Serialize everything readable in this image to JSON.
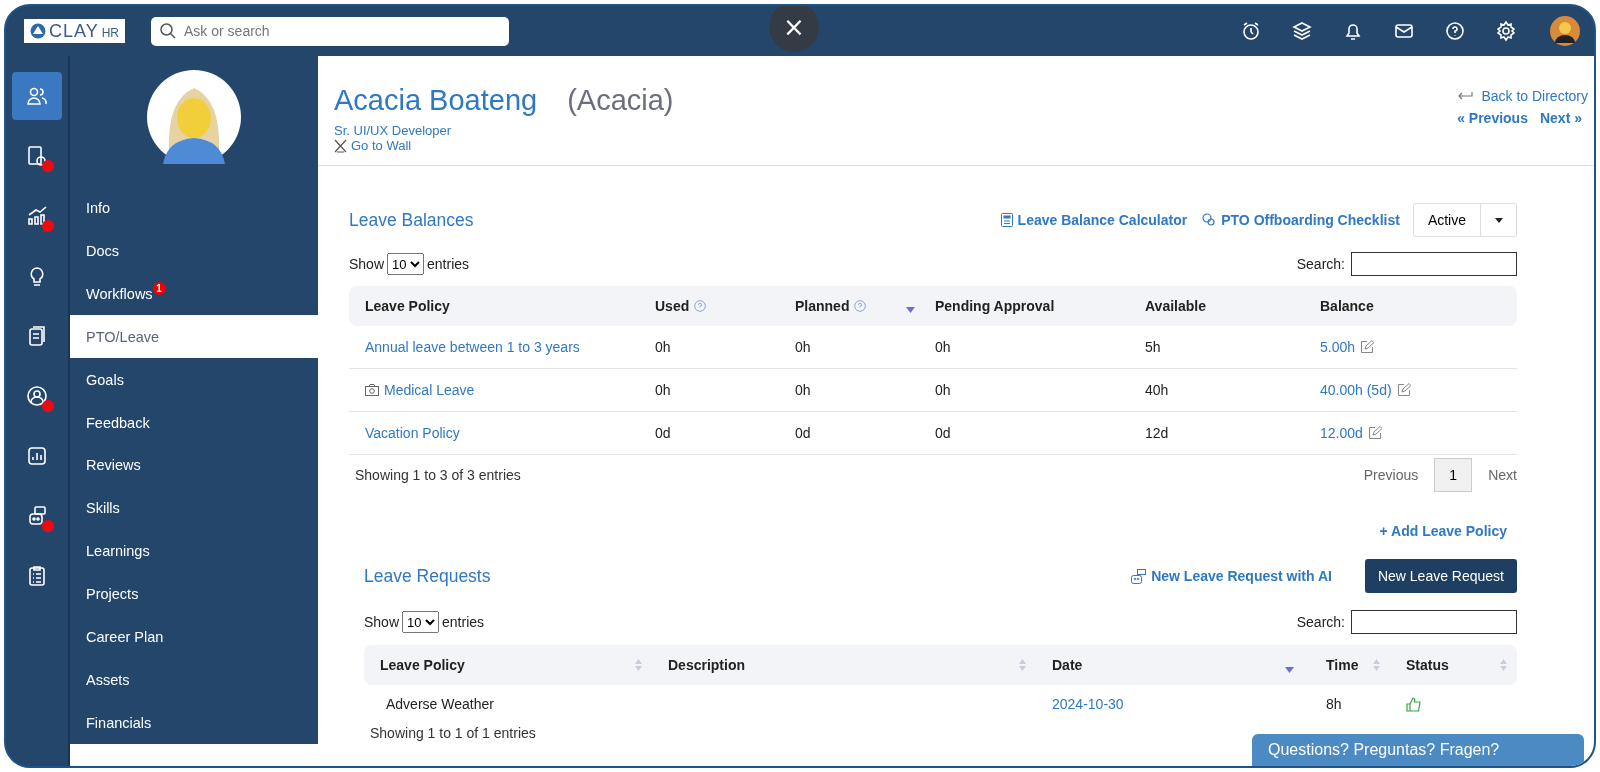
{
  "topbar": {
    "logo": "CLAY",
    "logo_suffix": "HR",
    "search": {
      "placeholder": "Ask or search"
    },
    "close": "×"
  },
  "rail": [
    {
      "selected": true,
      "alert": false
    },
    {
      "selected": false,
      "alert": true
    },
    {
      "selected": false,
      "alert": true
    },
    {
      "selected": false,
      "alert": false
    },
    {
      "selected": false,
      "alert": false
    },
    {
      "selected": false,
      "alert": true
    },
    {
      "selected": false,
      "alert": false
    },
    {
      "selected": false,
      "alert": true
    },
    {
      "selected": false,
      "alert": false
    }
  ],
  "sidebar": {
    "items": [
      {
        "label": "Info",
        "selected": false
      },
      {
        "label": "Docs",
        "selected": false
      },
      {
        "label": "Workflows",
        "selected": false,
        "badge": "1"
      },
      {
        "label": "PTO/Leave",
        "selected": true
      },
      {
        "label": "Goals",
        "selected": false
      },
      {
        "label": "Feedback",
        "selected": false
      },
      {
        "label": "Reviews",
        "selected": false
      },
      {
        "label": "Skills",
        "selected": false
      },
      {
        "label": "Learnings",
        "selected": false
      },
      {
        "label": "Projects",
        "selected": false
      },
      {
        "label": "Career Plan",
        "selected": false
      },
      {
        "label": "Assets",
        "selected": false
      },
      {
        "label": "Financials",
        "selected": false
      }
    ]
  },
  "profile": {
    "name": "Acacia Boateng",
    "nickname": "(Acacia)",
    "title": "Sr. UI/UX Developer",
    "wall_link": "Go to Wall",
    "back": "Back to Directory",
    "previous": "« Previous",
    "next": "Next »"
  },
  "leave_balances": {
    "title": "Leave Balances",
    "calculator": "Leave Balance Calculator",
    "checklist": "PTO Offboarding Checklist",
    "status": "Active",
    "show": "Show",
    "page_size": "10",
    "entries": "entries",
    "search_label": "Search:",
    "columns": [
      {
        "label": "Leave Policy",
        "help": false,
        "sorted": false
      },
      {
        "label": "Used",
        "help": true,
        "sorted": false
      },
      {
        "label": "Planned",
        "help": true,
        "sorted": true
      },
      {
        "label": "Pending Approval",
        "help": false,
        "sorted": false
      },
      {
        "label": "Available",
        "help": false,
        "sorted": false
      },
      {
        "label": "Balance",
        "help": false,
        "sorted": false
      }
    ],
    "rows": [
      {
        "policy": "Annual leave between 1 to 3 years",
        "camera": false,
        "used": "0h",
        "planned": "0h",
        "pending": "0h",
        "available": "5h",
        "balance": "5.00h"
      },
      {
        "policy": "Medical Leave",
        "camera": true,
        "used": "0h",
        "planned": "0h",
        "pending": "0h",
        "available": "40h",
        "balance": "40.00h (5d)"
      },
      {
        "policy": "Vacation Policy",
        "camera": false,
        "used": "0d",
        "planned": "0d",
        "pending": "0d",
        "available": "12d",
        "balance": "12.00d"
      }
    ],
    "info": "Showing 1 to 3 of 3 entries",
    "pagination": {
      "previous": "Previous",
      "page": "1",
      "next": "Next"
    },
    "add_policy": "+ Add Leave Policy"
  },
  "leave_requests": {
    "title": "Leave Requests",
    "ai_link": "New Leave Request with AI",
    "new_button": "New Leave Request",
    "show": "Show",
    "page_size": "10",
    "entries": "entries",
    "search_label": "Search:",
    "columns": [
      {
        "label": "Leave Policy",
        "sorted": false
      },
      {
        "label": "Description",
        "sorted": false
      },
      {
        "label": "Date",
        "sorted": true
      },
      {
        "label": "Time",
        "sorted": false
      },
      {
        "label": "Status",
        "sorted": false
      }
    ],
    "rows": [
      {
        "policy": "Adverse Weather",
        "date": "2024-10-30",
        "time": "8h",
        "approved": true
      }
    ],
    "info": "Showing 1 to 1 of 1 entries"
  },
  "chat": "Questions? Preguntas? Fragen?"
}
